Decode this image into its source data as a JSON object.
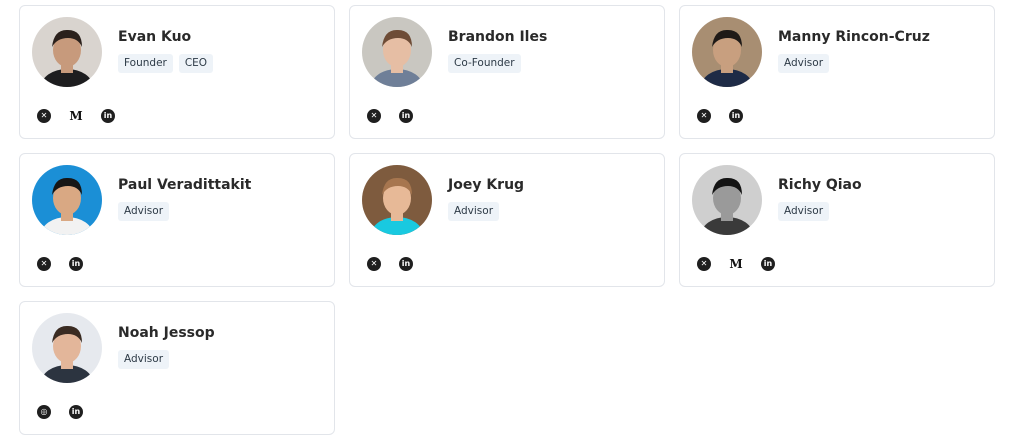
{
  "team": [
    {
      "name": "Evan Kuo",
      "roles": [
        "Founder",
        "CEO"
      ],
      "socials": [
        "x-icon",
        "medium-icon",
        "linkedin-icon"
      ],
      "avatar_colors": {
        "bg": "#d9d4cf",
        "skin": "#c79a7c",
        "hair": "#2b211c",
        "shirt": "#1d1d1f"
      }
    },
    {
      "name": "Brandon Iles",
      "roles": [
        "Co-Founder"
      ],
      "socials": [
        "x-icon",
        "linkedin-icon"
      ],
      "avatar_colors": {
        "bg": "#c9c7c1",
        "skin": "#e6bea4",
        "hair": "#6e4c36",
        "shirt": "#6f7f98"
      }
    },
    {
      "name": "Manny Rincon-Cruz",
      "roles": [
        "Advisor"
      ],
      "socials": [
        "x-icon",
        "linkedin-icon"
      ],
      "avatar_colors": {
        "bg": "#a88e72",
        "skin": "#c89f7f",
        "hair": "#1f1a17",
        "shirt": "#1e2b46"
      }
    },
    {
      "name": "Paul Veradittakit",
      "roles": [
        "Advisor"
      ],
      "socials": [
        "x-icon",
        "linkedin-icon"
      ],
      "avatar_colors": {
        "bg": "#1b8fd6",
        "skin": "#d9a883",
        "hair": "#161616",
        "shirt": "#f2f2f2"
      }
    },
    {
      "name": "Joey Krug",
      "roles": [
        "Advisor"
      ],
      "socials": [
        "x-icon",
        "linkedin-icon"
      ],
      "avatar_colors": {
        "bg": "#7e5b3e",
        "skin": "#e7b997",
        "hair": "#a7764f",
        "shirt": "#19c9e0"
      }
    },
    {
      "name": "Richy Qiao",
      "roles": [
        "Advisor"
      ],
      "socials": [
        "x-icon",
        "medium-icon",
        "linkedin-icon"
      ],
      "avatar_colors": {
        "bg": "#cfcfcf",
        "skin": "#9a9a9a",
        "hair": "#141414",
        "shirt": "#3a3a3a"
      }
    },
    {
      "name": "Noah Jessop",
      "roles": [
        "Advisor"
      ],
      "socials": [
        "globe-icon",
        "linkedin-icon"
      ],
      "avatar_colors": {
        "bg": "#e6e9ee",
        "skin": "#e3b69a",
        "hair": "#3a2b22",
        "shirt": "#2c3440"
      }
    }
  ]
}
